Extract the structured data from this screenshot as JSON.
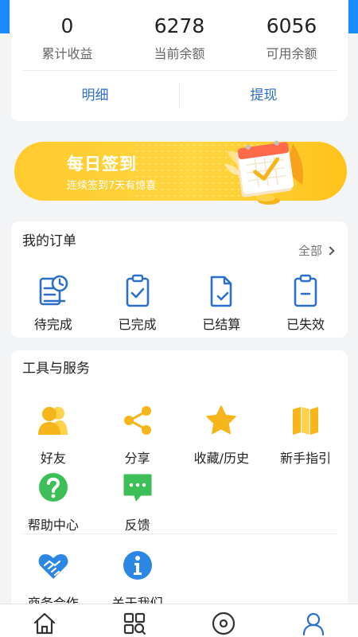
{
  "balance": {
    "stats": [
      {
        "value": "0",
        "label": "累计收益"
      },
      {
        "value": "6278",
        "label": "当前余额"
      },
      {
        "value": "6056",
        "label": "可用余额"
      }
    ],
    "detail_label": "明细",
    "withdraw_label": "提现"
  },
  "banner": {
    "title": "每日签到",
    "subtitle": "连续签到7天有惊喜"
  },
  "orders": {
    "title": "我的订单",
    "all_label": "全部",
    "items": [
      {
        "label": "待完成",
        "icon": "pending-order-icon"
      },
      {
        "label": "已完成",
        "icon": "completed-order-icon"
      },
      {
        "label": "已结算",
        "icon": "settled-order-icon"
      },
      {
        "label": "已失效",
        "icon": "expired-order-icon"
      }
    ]
  },
  "tools": {
    "title": "工具与服务",
    "items": [
      {
        "label": "好友",
        "icon": "friends-icon"
      },
      {
        "label": "分享",
        "icon": "share-icon"
      },
      {
        "label": "收藏/历史",
        "icon": "star-icon"
      },
      {
        "label": "新手指引",
        "icon": "map-icon"
      },
      {
        "label": "帮助中心",
        "icon": "help-icon"
      },
      {
        "label": "反馈",
        "icon": "feedback-icon"
      }
    ],
    "items2": [
      {
        "label": "商务合作",
        "icon": "handshake-icon"
      },
      {
        "label": "关于我们",
        "icon": "info-icon"
      }
    ]
  },
  "nav": [
    {
      "icon": "home-icon"
    },
    {
      "icon": "category-search-icon"
    },
    {
      "icon": "compass-icon"
    },
    {
      "icon": "profile-icon",
      "active": true
    }
  ],
  "colors": {
    "accent_blue": "#2b6ecb",
    "yellow": "#f7b51c",
    "green": "#3cbf57",
    "banner": "#ffd640"
  }
}
